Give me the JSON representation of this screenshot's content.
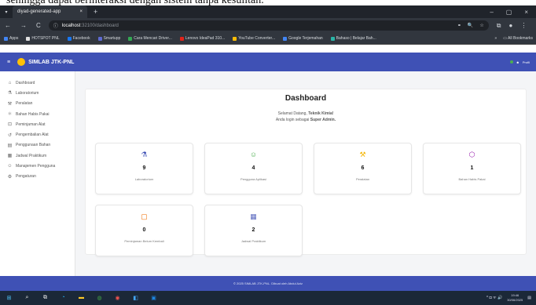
{
  "doc_text": "sehingga dapat berinteraksi dengan sistem tanpa kesulitan.",
  "browser": {
    "menu_glyph": "▾",
    "tab_title": "diyad-generated-app",
    "tab_close": "×",
    "new_tab": "+",
    "win_min": "–",
    "win_max": "▢",
    "win_close": "×",
    "back": "←",
    "forward": "→",
    "reload": "C",
    "url_host": "localhost",
    "url_path": ":32100/dashboard",
    "url_icons": [
      "⚭",
      "🔍",
      "☆"
    ],
    "ext_icons": [
      "⧉",
      "●",
      "⋮"
    ],
    "bookmarks": [
      {
        "label": "Apps",
        "color": "#4285f4"
      },
      {
        "label": "HOTSPOT PNL",
        "color": "#e0e0e0"
      },
      {
        "label": "Facebook",
        "color": "#1877f2"
      },
      {
        "label": "Smartupp",
        "color": "#5e6ad2"
      },
      {
        "label": "Cara Mencari Driver...",
        "color": "#34a853"
      },
      {
        "label": "Lenovo IdeaPad 310...",
        "color": "#e2231a"
      },
      {
        "label": "YouTube Converter...",
        "color": "#fbbc05"
      },
      {
        "label": "Google Terjemahan",
        "color": "#4285f4"
      },
      {
        "label": "Bahaso | Belajar Bah...",
        "color": "#2ab4a6"
      }
    ],
    "bm_more": "»",
    "all_bookmarks": "All Bookmarks"
  },
  "app": {
    "brand": "SIMLAB JTK-PNL",
    "hamburger": "≡",
    "user_label": "Profil"
  },
  "sidebar": {
    "items": [
      {
        "icon": "⌂",
        "icon_name": "home-icon",
        "label": "Dashboard"
      },
      {
        "icon": "⚗",
        "icon_name": "flask-icon",
        "label": "Laboratorium"
      },
      {
        "icon": "⚒",
        "icon_name": "tools-icon",
        "label": "Peralatan"
      },
      {
        "icon": "⚛",
        "icon_name": "chemical-icon",
        "label": "Bahan Habis Pakai"
      },
      {
        "icon": "⊡",
        "icon_name": "borrow-icon",
        "label": "Peminjaman Alat"
      },
      {
        "icon": "↺",
        "icon_name": "return-icon",
        "label": "Pengembalian Alat"
      },
      {
        "icon": "▤",
        "icon_name": "clipboard-icon",
        "label": "Penggunaan Bahan"
      },
      {
        "icon": "▦",
        "icon_name": "calendar-icon",
        "label": "Jadwal Praktikum"
      },
      {
        "icon": "☺",
        "icon_name": "users-icon",
        "label": "Manajemen Pengguna"
      },
      {
        "icon": "⚙",
        "icon_name": "gear-icon",
        "label": "Pengaturan"
      }
    ]
  },
  "dashboard": {
    "title": "Dashboard",
    "welcome_prefix": "Selamat Datang, ",
    "welcome_name": "Teknik Kimia!",
    "login_prefix": "Anda login sebagai ",
    "login_role": "Super Admin.",
    "stats": [
      {
        "icon": "⚗",
        "icon_name": "flask-icon",
        "color": "#3f51b5",
        "value": "9",
        "label": "Laboratorium"
      },
      {
        "icon": "☺",
        "icon_name": "users-icon",
        "color": "#4caf50",
        "value": "4",
        "label": "Pengguna Aplikasi"
      },
      {
        "icon": "⚒",
        "icon_name": "tools-icon",
        "color": "#f4b400",
        "value": "6",
        "label": "Peralatan"
      },
      {
        "icon": "⬡",
        "icon_name": "cube-icon",
        "color": "#9c27b0",
        "value": "1",
        "label": "Bahan Habis Pakai"
      },
      {
        "icon": "▢",
        "icon_name": "box-icon",
        "color": "#ef6c00",
        "value": "0",
        "label": "Peminjaman Belum Kembali"
      },
      {
        "icon": "▦",
        "icon_name": "calendar-icon",
        "color": "#5c6bc0",
        "value": "2",
        "label": "Jadwal Praktikum"
      }
    ]
  },
  "footer": {
    "text": "© 2025 SIMLAB JTK-PNL. Dibuat oleh Abdul Aziz"
  },
  "taskbar": {
    "icons": [
      {
        "glyph": "⊞",
        "name": "windows-start-icon",
        "color": "#4fc3f7"
      },
      {
        "glyph": "⌕",
        "name": "search-icon",
        "color": "#e8e8e8"
      },
      {
        "glyph": "⧉",
        "name": "task-view-icon",
        "color": "#e8e8e8"
      },
      {
        "glyph": "◔",
        "name": "edge-icon",
        "color": "#29b6f6"
      },
      {
        "glyph": "▬",
        "name": "file-explorer-icon",
        "color": "#ffca28"
      },
      {
        "glyph": "◍",
        "name": "whatsapp-icon",
        "color": "#43a047"
      },
      {
        "glyph": "◉",
        "name": "chrome-icon",
        "color": "#ef5350"
      },
      {
        "glyph": "◧",
        "name": "vscode-icon",
        "color": "#42a5f5"
      },
      {
        "glyph": "▣",
        "name": "word-icon",
        "color": "#1e88e5"
      }
    ],
    "tray_text": "^ ◘ ᯤ 🔊",
    "time": "19:46",
    "date": "30/06/2025",
    "notif": "▤"
  }
}
